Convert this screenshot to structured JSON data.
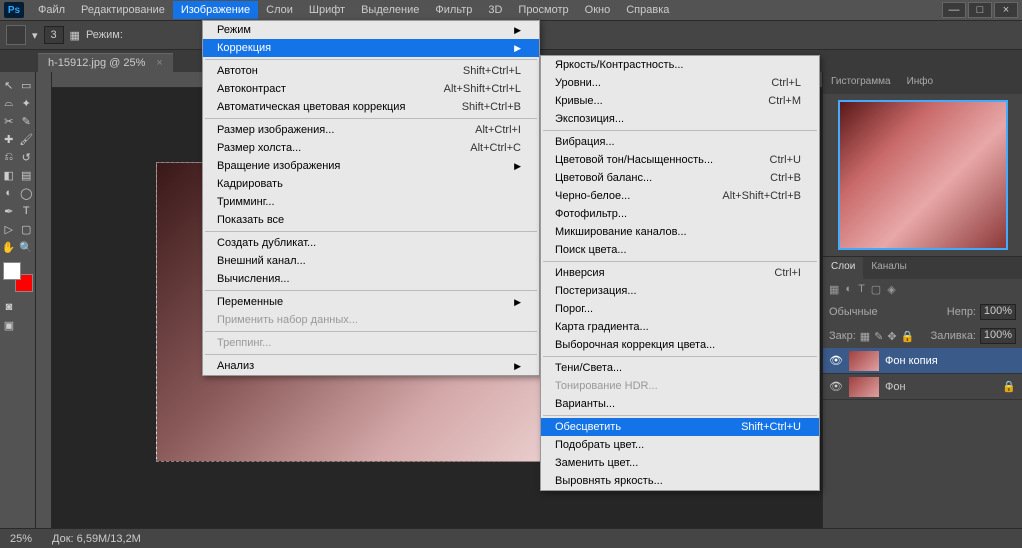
{
  "app": {
    "logo": "Ps"
  },
  "menubar": [
    "Файл",
    "Редактирование",
    "Изображение",
    "Слои",
    "Шрифт",
    "Выделение",
    "Фильтр",
    "3D",
    "Просмотр",
    "Окно",
    "Справка"
  ],
  "menubar_active_index": 2,
  "winbtn": {
    "min": "—",
    "max": "□",
    "close": "×"
  },
  "optbar": {
    "num": "3",
    "mode_lbl": "Режим:"
  },
  "tab": {
    "title": "h-15912.jpg @ 25%",
    "close": "×"
  },
  "dd1": [
    {
      "t": "item",
      "label": "Режим",
      "arrow": true
    },
    {
      "t": "item",
      "label": "Коррекция",
      "arrow": true,
      "hov": true
    },
    {
      "t": "sep"
    },
    {
      "t": "item",
      "label": "Автотон",
      "sc": "Shift+Ctrl+L"
    },
    {
      "t": "item",
      "label": "Автоконтраст",
      "sc": "Alt+Shift+Ctrl+L"
    },
    {
      "t": "item",
      "label": "Автоматическая цветовая коррекция",
      "sc": "Shift+Ctrl+B"
    },
    {
      "t": "sep"
    },
    {
      "t": "item",
      "label": "Размер изображения...",
      "sc": "Alt+Ctrl+I"
    },
    {
      "t": "item",
      "label": "Размер холста...",
      "sc": "Alt+Ctrl+C"
    },
    {
      "t": "item",
      "label": "Вращение изображения",
      "arrow": true
    },
    {
      "t": "item",
      "label": "Кадрировать"
    },
    {
      "t": "item",
      "label": "Тримминг..."
    },
    {
      "t": "item",
      "label": "Показать все"
    },
    {
      "t": "sep"
    },
    {
      "t": "item",
      "label": "Создать дубликат..."
    },
    {
      "t": "item",
      "label": "Внешний канал..."
    },
    {
      "t": "item",
      "label": "Вычисления..."
    },
    {
      "t": "sep"
    },
    {
      "t": "item",
      "label": "Переменные",
      "arrow": true
    },
    {
      "t": "item",
      "label": "Применить набор данных...",
      "dis": true
    },
    {
      "t": "sep"
    },
    {
      "t": "item",
      "label": "Треппинг...",
      "dis": true
    },
    {
      "t": "sep"
    },
    {
      "t": "item",
      "label": "Анализ",
      "arrow": true
    }
  ],
  "dd2": [
    {
      "t": "item",
      "label": "Яркость/Контрастность..."
    },
    {
      "t": "item",
      "label": "Уровни...",
      "sc": "Ctrl+L"
    },
    {
      "t": "item",
      "label": "Кривые...",
      "sc": "Ctrl+M"
    },
    {
      "t": "item",
      "label": "Экспозиция..."
    },
    {
      "t": "sep"
    },
    {
      "t": "item",
      "label": "Вибрация..."
    },
    {
      "t": "item",
      "label": "Цветовой тон/Насыщенность...",
      "sc": "Ctrl+U"
    },
    {
      "t": "item",
      "label": "Цветовой баланс...",
      "sc": "Ctrl+B"
    },
    {
      "t": "item",
      "label": "Черно-белое...",
      "sc": "Alt+Shift+Ctrl+B"
    },
    {
      "t": "item",
      "label": "Фотофильтр..."
    },
    {
      "t": "item",
      "label": "Микширование каналов..."
    },
    {
      "t": "item",
      "label": "Поиск цвета..."
    },
    {
      "t": "sep"
    },
    {
      "t": "item",
      "label": "Инверсия",
      "sc": "Ctrl+I"
    },
    {
      "t": "item",
      "label": "Постеризация..."
    },
    {
      "t": "item",
      "label": "Порог..."
    },
    {
      "t": "item",
      "label": "Карта градиента..."
    },
    {
      "t": "item",
      "label": "Выборочная коррекция цвета..."
    },
    {
      "t": "sep"
    },
    {
      "t": "item",
      "label": "Тени/Света..."
    },
    {
      "t": "item",
      "label": "Тонирование HDR...",
      "dis": true
    },
    {
      "t": "item",
      "label": "Варианты..."
    },
    {
      "t": "sep"
    },
    {
      "t": "item",
      "label": "Обесцветить",
      "sc": "Shift+Ctrl+U",
      "hov": true
    },
    {
      "t": "item",
      "label": "Подобрать цвет..."
    },
    {
      "t": "item",
      "label": "Заменить цвет..."
    },
    {
      "t": "item",
      "label": "Выровнять яркость..."
    }
  ],
  "panel_tabs_top": [
    "Гистограмма",
    "Инфо"
  ],
  "panel_tabs_mid": [
    "Слои",
    "Каналы"
  ],
  "layer_ctrl": {
    "normal": "Обычные",
    "opacity_lbl": "Непр:",
    "opacity_val": "100%",
    "lock_lbl": "Заливка:",
    "fill_val": "100%",
    "lock_prefix": "Закр:"
  },
  "layers": [
    {
      "name": "Фон копия",
      "sel": true
    },
    {
      "name": "Фон",
      "sel": false,
      "locked": true
    }
  ],
  "status": {
    "zoom": "25%",
    "doc": "Док: 6,59M/13,2M"
  }
}
